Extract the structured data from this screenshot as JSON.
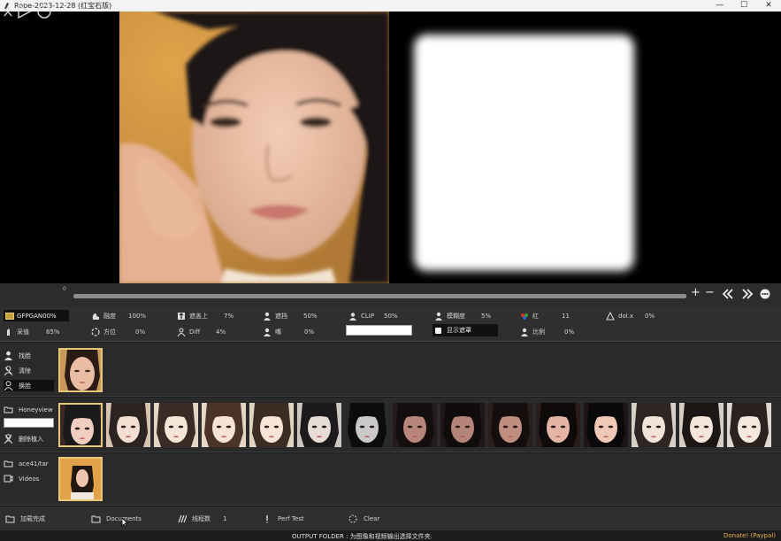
{
  "window": {
    "title": "Rope-2023-12-28 (红宝石版)",
    "minimize": "—",
    "maximize": "☐",
    "close": "✕"
  },
  "transport": {
    "frame": "0"
  },
  "params": {
    "enhancer": "GFPGAN00%",
    "enhance_label": "采值",
    "enhance_value": "85%",
    "blend_label": "融度",
    "blend_value": "100%",
    "position_label": "方位",
    "position_value": "0%",
    "top_label": "遮盖上",
    "top_value": "7%",
    "diff_label": "Diff",
    "diff_value": "4%",
    "occlude_label": "遮挡",
    "occlude_value": "50%",
    "mouth_label": "嘴",
    "mouth_value": "0%",
    "clip_label": "CLIP",
    "clip_value": "50%",
    "blur_label": "模糊度",
    "blur_value": "5%",
    "show_mask_label": "显示遮罩",
    "red_label": "红",
    "red_value": "11",
    "ratio_label": "比例",
    "ratio_value": "0%",
    "dol_label": "dol.x",
    "dol_value": "0%"
  },
  "source_faces": {
    "find_label": "找脸",
    "clear_label": "清除",
    "swap_label": "换脸"
  },
  "embeddings": {
    "folder_label": "Honeyview",
    "delete_label": "删除植入",
    "search_value": ""
  },
  "videos": {
    "folder_label": "ace41/tar",
    "videos_label": "Videos"
  },
  "bottom": {
    "load_label": "加载完成",
    "documents_label": "Documents",
    "threads_label": "线程数",
    "threads_value": "1",
    "perf_label": "Perf Test",
    "clear_label": "Clear"
  },
  "status": {
    "text": "OUTPUT FOLDER : 为图像和视频输出选择文件夹.",
    "donate": "Donate! (Paypal)"
  },
  "colors": {
    "accent_border": "#e8c77b",
    "donate": "#e8b24a",
    "panel": "#2a2a2a"
  }
}
